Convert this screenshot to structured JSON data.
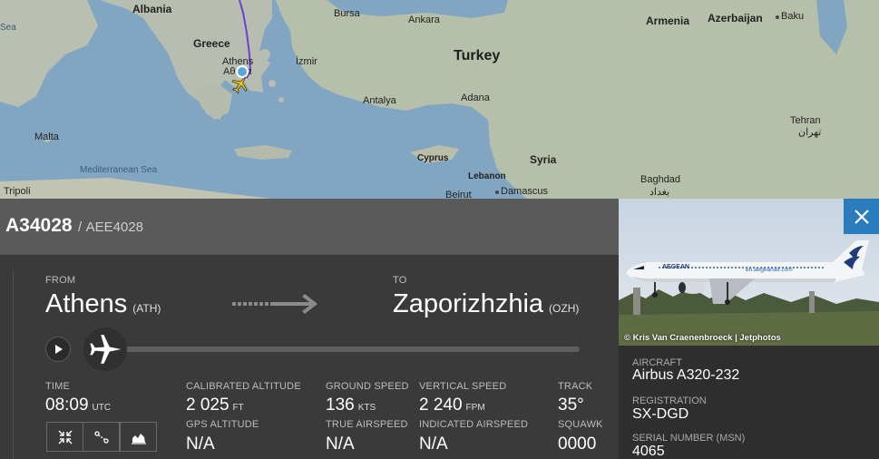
{
  "map": {
    "labels": {
      "albania": "Albania",
      "greece": "Greece",
      "athens": "Athens",
      "athens_local": "Αθήνα",
      "izmir": "İzmir",
      "bursa": "Bursa",
      "ankara": "Ankara",
      "turkey": "Turkey",
      "armenia": "Armenia",
      "azerbaijan": "Azerbaijan",
      "baku": "Baku",
      "antalya": "Antalya",
      "adana": "Adana",
      "malta": "Malta",
      "mediterranean": "Mediterranean Sea",
      "cyprus": "Cyprus",
      "syria": "Syria",
      "lebanon": "Lebanon",
      "beirut": "Beirut",
      "damascus": "Damascus",
      "baghdad": "Baghdad",
      "baghdad_local": "بغداد",
      "tehran": "Tehran",
      "tehran_local": "تهران",
      "tripoli": "Tripoli",
      "sea_left": "Sea"
    }
  },
  "flight": {
    "callsign": "A34028",
    "separator": "/",
    "icao": "AEE4028"
  },
  "route": {
    "from_label": "FROM",
    "from_city": "Athens",
    "from_code": "(ATH)",
    "to_label": "TO",
    "to_city": "Zaporizhzhia",
    "to_code": "(OZH)"
  },
  "progress": 0.0,
  "stats": {
    "time_label": "TIME",
    "time_value": "08:09",
    "time_unit": "UTC",
    "cal_alt_label": "CALIBRATED ALTITUDE",
    "cal_alt_value": "2 025",
    "cal_alt_unit": "FT",
    "gps_alt_label": "GPS ALTITUDE",
    "gps_alt_value": "N/A",
    "ground_speed_label": "GROUND SPEED",
    "ground_speed_value": "136",
    "ground_speed_unit": "KTS",
    "true_airspeed_label": "TRUE AIRSPEED",
    "true_airspeed_value": "N/A",
    "vertical_speed_label": "VERTICAL SPEED",
    "vertical_speed_value": "2 240",
    "vertical_speed_unit": "FPM",
    "indicated_airspeed_label": "INDICATED AIRSPEED",
    "indicated_airspeed_value": "N/A",
    "track_label": "TRACK",
    "track_value": "35°",
    "squawk_label": "SQUAWK",
    "squawk_value": "0000"
  },
  "aircraft": {
    "photo_credit": "© Kris Van Craenenbroeck | Jetphotos",
    "photo_livery": "AEGEAN",
    "photo_url_text": "en.aegeanair.com",
    "aircraft_label": "AIRCRAFT",
    "aircraft_value": "Airbus A320-232",
    "registration_label": "REGISTRATION",
    "registration_value": "SX-DGD",
    "serial_label": "SERIAL NUMBER (MSN)",
    "serial_value": "4065"
  },
  "colors": {
    "accent_blue": "#2a7cbd",
    "route_line": "#6b3fd6",
    "plane_yellow": "#f2c300"
  }
}
